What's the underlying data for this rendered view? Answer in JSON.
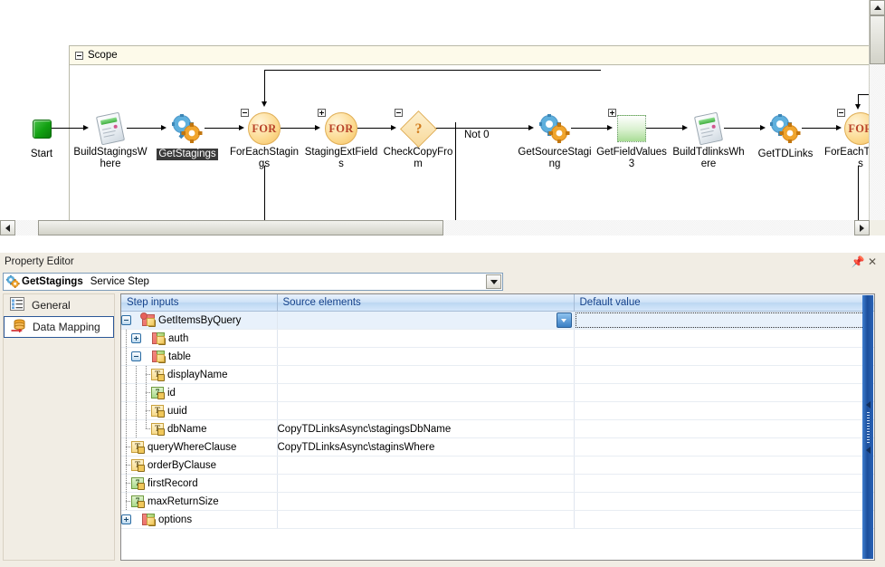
{
  "diagram": {
    "scope": {
      "label": "Scope",
      "expander": "minus"
    },
    "branch_label": "Not 0",
    "nodes": [
      {
        "id": "start",
        "label": "Start",
        "kind": "terminal",
        "glyph": "start-square"
      },
      {
        "id": "buildstagings",
        "label": "BuildStagingsWhere",
        "kind": "script",
        "glyph": "clipboard-icon"
      },
      {
        "id": "getstagings",
        "label": "GetStagings",
        "kind": "service",
        "glyph": "gears-icon",
        "selected": true
      },
      {
        "id": "foreachstagings",
        "label": "ForEachStagings",
        "kind": "loop",
        "glyph": "for-circle",
        "badge": "FOR",
        "expander": "minus"
      },
      {
        "id": "stagingextfields",
        "label": "StagingExtFields",
        "kind": "loop",
        "glyph": "for-circle",
        "badge": "FOR",
        "expander": "plus"
      },
      {
        "id": "checkcopyfrom",
        "label": "CheckCopyFrom",
        "kind": "decision",
        "glyph": "diamond-icon",
        "badge": "?",
        "expander": "minus"
      },
      {
        "id": "getsourcestaging",
        "label": "GetSourceStaging",
        "kind": "service",
        "glyph": "gears-icon"
      },
      {
        "id": "getfieldvalues3",
        "label": "GetFieldValues3",
        "kind": "group",
        "glyph": "green-square",
        "expander": "plus"
      },
      {
        "id": "buildtdlinkswhere",
        "label": "BuildTdlinksWhere",
        "kind": "script",
        "glyph": "clipboard-icon"
      },
      {
        "id": "gettdlinks",
        "label": "GetTDLinks",
        "kind": "service",
        "glyph": "gears-icon"
      },
      {
        "id": "foreachtdlinks",
        "label": "ForEachTDLinks",
        "kind": "loop",
        "glyph": "for-circle",
        "badge": "FOR",
        "expander": "minus"
      }
    ]
  },
  "property_editor": {
    "panel_title": "Property Editor",
    "pin_icon": "pin-icon",
    "close_icon": "close-icon",
    "combo": {
      "icon": "gears-icon",
      "name": "GetStagings",
      "kind": "Service Step",
      "chevron": "chevron-down-icon"
    },
    "tabs": [
      {
        "id": "general",
        "label": "General",
        "icon": "list-icon",
        "selected": false
      },
      {
        "id": "data-mapping",
        "label": "Data Mapping",
        "icon": "database-arrow-icon",
        "selected": true
      }
    ],
    "grid": {
      "columns": [
        "Step inputs",
        "Source elements",
        "Default value"
      ],
      "rows": [
        {
          "name": "GetItemsByQuery",
          "depth": 0,
          "expander": "minus",
          "type": "complex-star",
          "source": "",
          "source_button": true,
          "default": "",
          "default_focus": true,
          "highlight": true
        },
        {
          "name": "auth",
          "depth": 1,
          "expander": "plus",
          "type": "complex",
          "source": "",
          "default": ""
        },
        {
          "name": "table",
          "depth": 1,
          "expander": "minus",
          "type": "complex",
          "source": "",
          "default": ""
        },
        {
          "name": "displayName",
          "depth": 2,
          "expander": "none",
          "type": "string",
          "source": "",
          "default": ""
        },
        {
          "name": "id",
          "depth": 2,
          "expander": "none",
          "type": "number",
          "source": "",
          "default": ""
        },
        {
          "name": "uuid",
          "depth": 2,
          "expander": "none",
          "type": "string",
          "source": "",
          "default": ""
        },
        {
          "name": "dbName",
          "depth": 2,
          "expander": "none",
          "type": "string",
          "source": "CopyTDLinksAsync\\stagingsDbName",
          "default": ""
        },
        {
          "name": "queryWhereClause",
          "depth": 1,
          "expander": "none",
          "type": "string",
          "source": "CopyTDLinksAsync\\staginsWhere",
          "default": ""
        },
        {
          "name": "orderByClause",
          "depth": 1,
          "expander": "none",
          "type": "string",
          "source": "",
          "default": ""
        },
        {
          "name": "firstRecord",
          "depth": 1,
          "expander": "none",
          "type": "number",
          "source": "",
          "default": ""
        },
        {
          "name": "maxReturnSize",
          "depth": 1,
          "expander": "none",
          "type": "number",
          "source": "",
          "default": ""
        },
        {
          "name": "options",
          "depth": 1,
          "expander": "plus",
          "type": "complex",
          "source": "",
          "default": ""
        }
      ]
    }
  },
  "scrollbars": {
    "vertical": {
      "up": "scroll-up-arrow",
      "down": "scroll-down-arrow"
    },
    "horizontal": {
      "left": "scroll-left-arrow",
      "right": "scroll-right-arrow"
    }
  },
  "colors": {
    "header_blue": "#15428b",
    "scope_header": "#fdfaea",
    "panel_bg": "#f1ede4",
    "selection": "#3a3a3a",
    "splitter_blue": "#1c4f9c"
  }
}
